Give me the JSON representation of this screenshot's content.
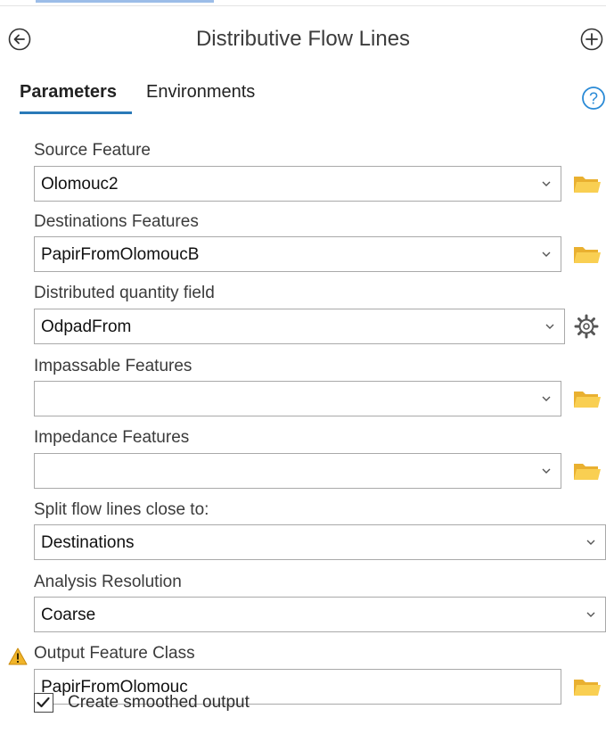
{
  "header": {
    "title": "Distributive Flow Lines",
    "back_icon": "back-arrow-circle-icon",
    "add_icon": "plus-circle-icon"
  },
  "tabs": [
    {
      "label": "Parameters",
      "active": true
    },
    {
      "label": "Environments",
      "active": false
    }
  ],
  "help_icon": "help-question-icon",
  "params": {
    "source": {
      "label": "Source Feature",
      "value": "Olomouc2"
    },
    "destinations": {
      "label": "Destinations Features",
      "value": "PapirFromOlomoucB"
    },
    "quantity": {
      "label": "Distributed quantity field",
      "value": "OdpadFrom"
    },
    "impassable": {
      "label": "Impassable Features",
      "value": ""
    },
    "impedance": {
      "label": "Impedance Features",
      "value": ""
    },
    "split": {
      "label": "Split flow lines close to:",
      "value": "Destinations"
    },
    "resolution": {
      "label": "Analysis Resolution",
      "value": "Coarse"
    },
    "output": {
      "label": "Output Feature Class",
      "value": "PapirFromOlomouc",
      "warning": true
    },
    "smoothed": {
      "label": "Create smoothed output",
      "checked": true
    }
  },
  "colors": {
    "tab_underline": "#2a7ab8",
    "help_blue": "#2a8ad6",
    "folder_yellow": "#f5c542",
    "warning_yellow": "#f0b429"
  }
}
